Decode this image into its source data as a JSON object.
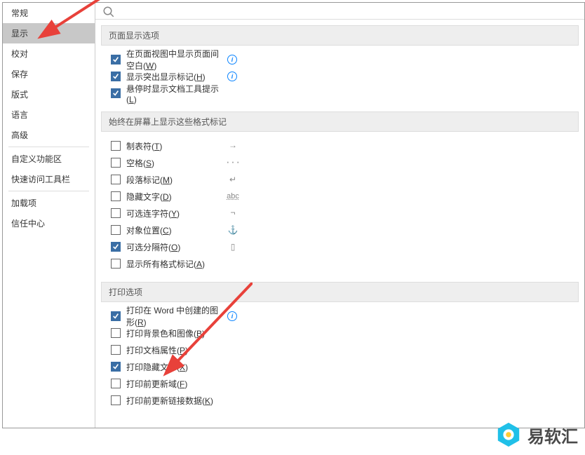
{
  "sidebar": {
    "items": [
      {
        "label": "常规",
        "active": false
      },
      {
        "label": "显示",
        "active": true
      },
      {
        "label": "校对",
        "active": false
      },
      {
        "label": "保存",
        "active": false
      },
      {
        "label": "版式",
        "active": false
      },
      {
        "label": "语言",
        "active": false
      },
      {
        "label": "高级",
        "active": false
      }
    ],
    "items2": [
      {
        "label": "自定义功能区",
        "active": false
      },
      {
        "label": "快速访问工具栏",
        "active": false
      }
    ],
    "items3": [
      {
        "label": "加载项",
        "active": false
      },
      {
        "label": "信任中心",
        "active": false
      }
    ]
  },
  "sections": {
    "pageDisplay": {
      "title": "页面显示选项",
      "options": [
        {
          "label": "在页面视图中显示页面间空白(",
          "key": "W",
          "tail": ")",
          "checked": true,
          "info": true
        },
        {
          "label": "显示突出显示标记(",
          "key": "H",
          "tail": ")",
          "checked": true,
          "info": true
        },
        {
          "label": "悬停时显示文档工具提示(",
          "key": "L",
          "tail": ")",
          "checked": true,
          "info": false
        }
      ]
    },
    "formatMarks": {
      "title": "始终在屏幕上显示这些格式标记",
      "options": [
        {
          "label": "制表符(",
          "key": "T",
          "tail": ")",
          "checked": false,
          "symbol": "→"
        },
        {
          "label": "空格(",
          "key": "S",
          "tail": ")",
          "checked": false,
          "symbol": "···"
        },
        {
          "label": "段落标记(",
          "key": "M",
          "tail": ")",
          "checked": false,
          "symbol": "↵"
        },
        {
          "label": "隐藏文字(",
          "key": "D",
          "tail": ")",
          "checked": false,
          "symbol": "abc"
        },
        {
          "label": "可选连字符(",
          "key": "Y",
          "tail": ")",
          "checked": false,
          "symbol": "¬"
        },
        {
          "label": "对象位置(",
          "key": "C",
          "tail": ")",
          "checked": false,
          "symbol": "⚓"
        },
        {
          "label": "可选分隔符(",
          "key": "O",
          "tail": ")",
          "checked": true,
          "symbol": "▯"
        },
        {
          "label": "显示所有格式标记(",
          "key": "A",
          "tail": ")",
          "checked": false,
          "symbol": ""
        }
      ]
    },
    "printOptions": {
      "title": "打印选项",
      "options": [
        {
          "label": "打印在 Word 中创建的图形(",
          "key": "R",
          "tail": ")",
          "checked": true,
          "info": true
        },
        {
          "label": "打印背景色和图像(",
          "key": "B",
          "tail": ")",
          "checked": false
        },
        {
          "label": "打印文档属性(",
          "key": "P",
          "tail": ")",
          "checked": false
        },
        {
          "label": "打印隐藏文字(",
          "key": "X",
          "tail": ")",
          "checked": true
        },
        {
          "label": "打印前更新域(",
          "key": "F",
          "tail": ")",
          "checked": false
        },
        {
          "label": "打印前更新链接数据(",
          "key": "K",
          "tail": ")",
          "checked": false
        }
      ]
    }
  },
  "watermark": {
    "text": "易软汇"
  },
  "colors": {
    "arrow": "#e8413a",
    "accent": "#3a6ea5",
    "logoBlue": "#20c0e8"
  }
}
